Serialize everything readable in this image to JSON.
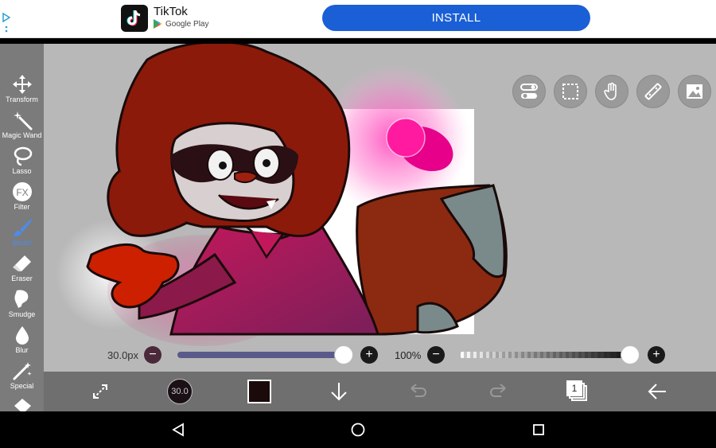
{
  "ad": {
    "app_name": "TikTok",
    "store_label": "Google Play",
    "install_label": "INSTALL",
    "icon": "tiktok-icon",
    "install_color": "#1a5fd6"
  },
  "tools": [
    {
      "label": "Transform",
      "icon": "move-arrows-icon"
    },
    {
      "label": "Magic Wand",
      "icon": "magic-wand-icon"
    },
    {
      "label": "Lasso",
      "icon": "lasso-icon"
    },
    {
      "label": "Filter",
      "icon": "fx-icon"
    },
    {
      "label": "Brush",
      "icon": "brush-icon",
      "active": true
    },
    {
      "label": "Eraser",
      "icon": "eraser-icon"
    },
    {
      "label": "Smudge",
      "icon": "smudge-icon"
    },
    {
      "label": "Blur",
      "icon": "blur-drop-icon"
    },
    {
      "label": "Special",
      "icon": "sparkle-pen-icon"
    }
  ],
  "fx_glyph": "FX",
  "top_buttons": [
    "toggle-icon",
    "selection-icon",
    "hand-icon",
    "ruler-icon",
    "image-icon"
  ],
  "brush": {
    "size_label": "30.0px",
    "size_value": 30.0,
    "size_badge": "30.0",
    "opacity_label": "100%",
    "opacity_value": 1.0,
    "minus": "−",
    "plus": "+"
  },
  "bottom_toolbar": {
    "layer_count": "1",
    "color": "#1a0a0a"
  },
  "colors": {
    "accent_active_tool": "#4a8cf0",
    "canvas_bg": "#b8b8b8",
    "toolbar_bg": "#7b7b7b"
  }
}
